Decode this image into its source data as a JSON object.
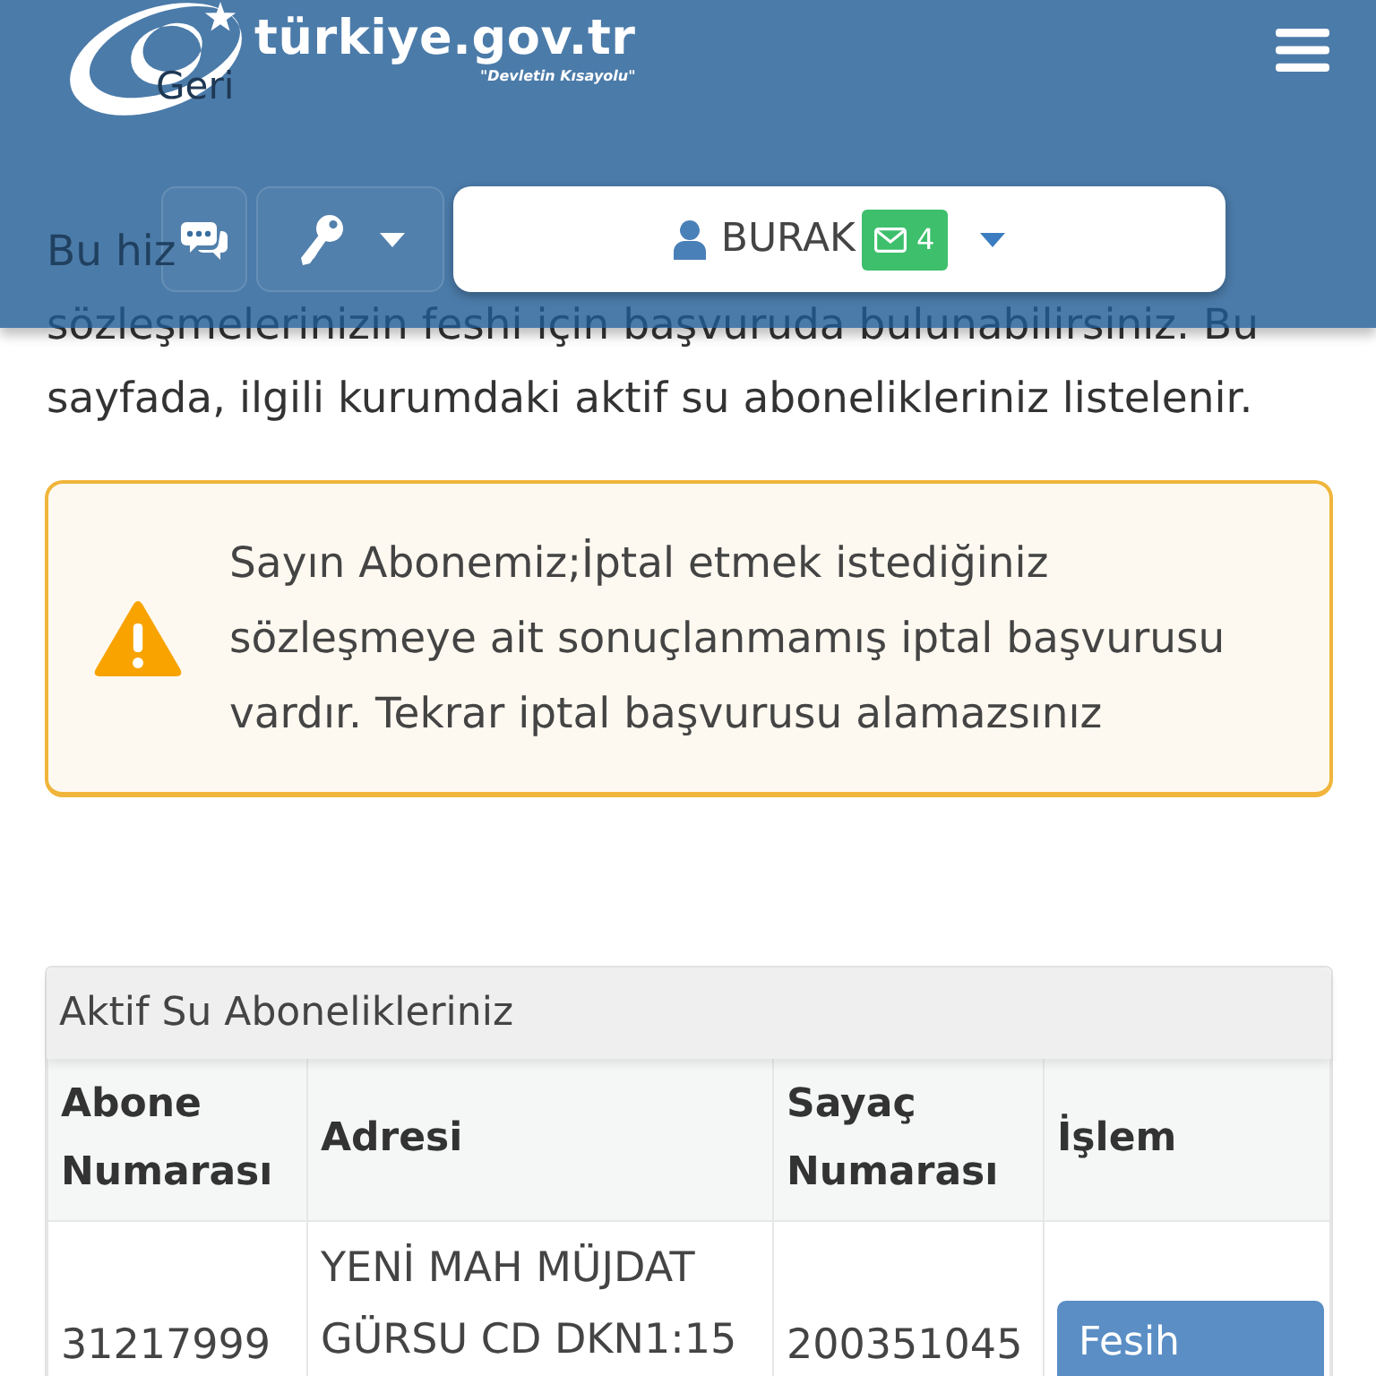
{
  "header": {
    "logo": {
      "title": "türkiye.gov.tr",
      "tagline": "\"Devletin Kısayolu\""
    },
    "user_menu": {
      "name": "BURAK",
      "unread_messages": "4"
    }
  },
  "back_link": "Geri",
  "intro": [
    "Bu hiz",
    "sözleşmelerinizin feshi için başvuruda bulunabilirsiniz. Bu sayfada, ilgili kurumdaki aktif su abonelikleriniz listelenir."
  ],
  "alert": {
    "kind": "warning",
    "text": "Sayın Abonemiz;İptal etmek istediğiniz sözleşmeye ait sonuçlanmamış iptal başvurusu vardır. Tekrar iptal başvurusu alamazsınız"
  },
  "subscriptions": {
    "title": "Aktif Su Abonelikleriniz",
    "columns": [
      "Abone Numarası",
      "Adresi",
      "Sayaç Numarası",
      "İşlem"
    ],
    "rows": [
      {
        "subscriber_number": "31217999",
        "address": "YENİ MAH MÜJDAT GÜRSU CD DKN1:15",
        "meter_number": "200351045",
        "action": "Fesih"
      }
    ]
  }
}
